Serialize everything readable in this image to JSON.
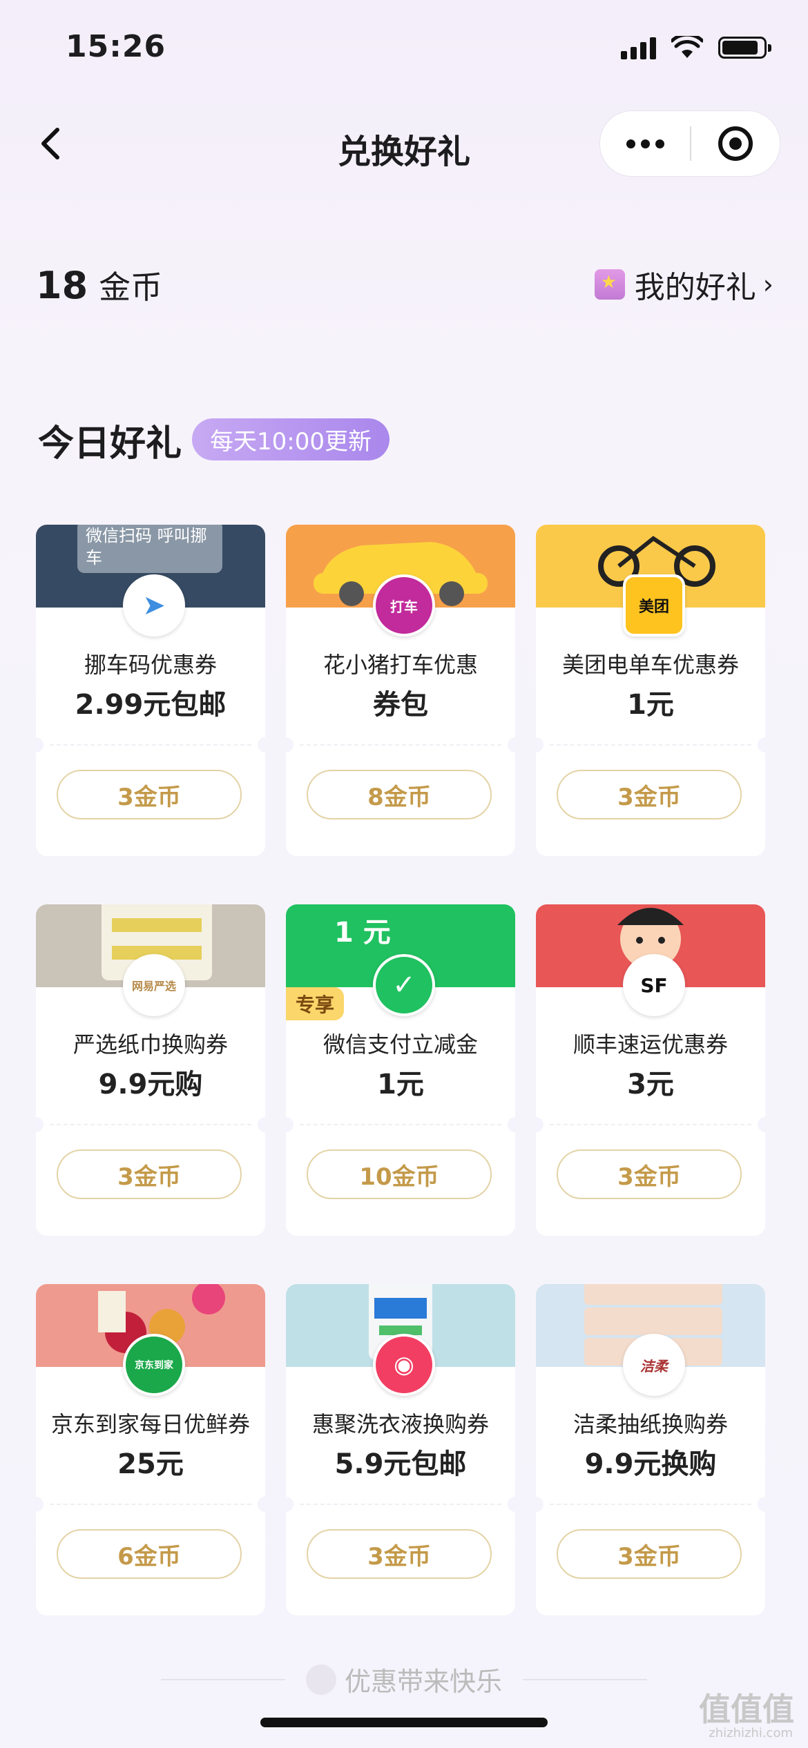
{
  "status": {
    "time": "15:26"
  },
  "nav": {
    "title": "兑换好礼"
  },
  "header": {
    "coin_count": "18",
    "coin_unit": "金币",
    "my_gifts": "我的好礼"
  },
  "section": {
    "title": "今日好礼",
    "badge": "每天10:00更新"
  },
  "cards": [
    {
      "name": "挪车码优惠券",
      "price": "2.99元包邮",
      "cost": "3金币",
      "logo": "➤",
      "banner_text": "微信扫码 呼叫挪车",
      "banner_color": "#364a63"
    },
    {
      "name": "花小猪打车优惠",
      "price": "券包",
      "cost": "8金币",
      "logo": "打车",
      "banner_color": "#f7a04a"
    },
    {
      "name": "美团电单车优惠券",
      "price": "1元",
      "cost": "3金币",
      "logo": "美团",
      "banner_color": "#fbc94a"
    },
    {
      "name": "严选纸巾换购券",
      "price": "9.9元购",
      "cost": "3金币",
      "logo": "网易严选",
      "banner_color": "#c9c3b8"
    },
    {
      "name": "微信支付立减金",
      "price": "1元",
      "cost": "10金币",
      "logo": "✓",
      "banner_text": "1 元",
      "tag": "专享",
      "banner_color": "#20c160"
    },
    {
      "name": "顺丰速运优惠券",
      "price": "3元",
      "cost": "3金币",
      "logo": "SF",
      "banner_color": "#e85656"
    },
    {
      "name": "京东到家每日优鲜券",
      "price": "25元",
      "cost": "6金币",
      "logo": "京东到家",
      "banner_color": "#ef9a8f"
    },
    {
      "name": "惠聚洗衣液换购券",
      "price": "5.9元包邮",
      "cost": "3金币",
      "logo": "◉",
      "banner_color": "#bfe0e6"
    },
    {
      "name": "洁柔抽纸换购券",
      "price": "9.9元换购",
      "cost": "3金币",
      "logo": "洁柔",
      "banner_color": "#d5e5f1"
    }
  ],
  "footer": {
    "text": "优惠带来快乐"
  },
  "watermark": {
    "main": "值值值",
    "sub": "zhizhizhi.com"
  }
}
